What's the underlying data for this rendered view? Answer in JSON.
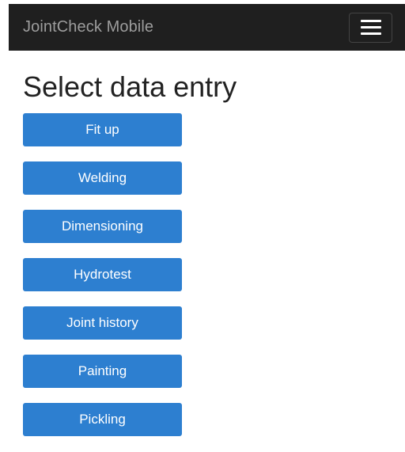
{
  "navbar": {
    "brand": "JointCheck Mobile",
    "menu_icon": "hamburger-menu-icon"
  },
  "heading": "Select data entry",
  "buttons": [
    {
      "label": "Fit up"
    },
    {
      "label": "Welding"
    },
    {
      "label": "Dimensioning"
    },
    {
      "label": "Hydrotest"
    },
    {
      "label": "Joint history"
    },
    {
      "label": "Painting"
    },
    {
      "label": "Pickling"
    }
  ],
  "colors": {
    "navbar_bg": "#1f1f1f",
    "brand_text": "#9d9d9d",
    "button_bg": "#2d7fd0",
    "button_text": "#ffffff"
  }
}
